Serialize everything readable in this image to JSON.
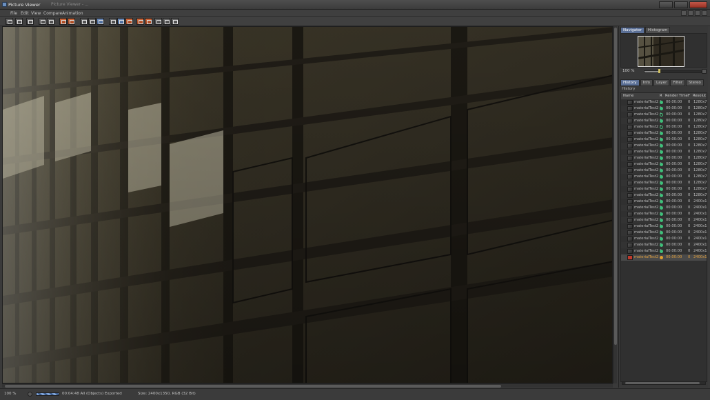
{
  "window": {
    "title": "Picture Viewer",
    "ghost_title": "Picture Viewer - ..."
  },
  "menu": {
    "items": [
      "File",
      "Edit",
      "View",
      "Compare",
      "Animation"
    ]
  },
  "toolbar": {
    "buttons": [
      "open-icon",
      "save-icon",
      "export-icon",
      "zoom-in-icon",
      "zoom-out-icon",
      "ab-compare-icon",
      "split-icon",
      "fit-icon",
      "region-icon",
      "channel-icon",
      "display-icon",
      "rgb-icon",
      "lut-icon",
      "alpha-icon",
      "ab-icon",
      "stereo-icon",
      "fullscreen-icon"
    ]
  },
  "navigator": {
    "tabs": [
      "Navigator",
      "Histogram"
    ],
    "zoom": "100 %",
    "zoom_fraction": 0.25
  },
  "info_tabs": [
    "History",
    "Info",
    "Layer",
    "Filter",
    "Stereo"
  ],
  "history": {
    "label": "History",
    "headers": {
      "name": "Name",
      "r": "R",
      "render_time": "Render Time",
      "f": "F",
      "resolution": "Resolut"
    },
    "rows": [
      {
        "name": "materialTest2 *",
        "time": "00:00:00",
        "f": "0",
        "res": "1280x7",
        "status": "done"
      },
      {
        "name": "materialTest2 *",
        "time": "00:00:00",
        "f": "0",
        "res": "1280x7",
        "status": "done"
      },
      {
        "name": "materialTest2 *",
        "time": "00:00:00",
        "f": "0",
        "res": "1280x7",
        "status": "open"
      },
      {
        "name": "materialTest2 *",
        "time": "00:00:00",
        "f": "0",
        "res": "1280x7",
        "status": "done"
      },
      {
        "name": "materialTest2 *",
        "time": "00:00:00",
        "f": "0",
        "res": "1280x7",
        "status": "open"
      },
      {
        "name": "materialTest2 *",
        "time": "00:00:00",
        "f": "0",
        "res": "1280x7",
        "status": "done"
      },
      {
        "name": "materialTest2 *",
        "time": "00:00:00",
        "f": "0",
        "res": "1280x7",
        "status": "done"
      },
      {
        "name": "materialTest2 *",
        "time": "00:00:00",
        "f": "0",
        "res": "1280x7",
        "status": "done"
      },
      {
        "name": "materialTest2 *",
        "time": "00:00:00",
        "f": "0",
        "res": "1280x7",
        "status": "done"
      },
      {
        "name": "materialTest2 *",
        "time": "00:00:00",
        "f": "0",
        "res": "1280x7",
        "status": "done"
      },
      {
        "name": "materialTest2 *",
        "time": "00:00:00",
        "f": "0",
        "res": "1280x7",
        "status": "done"
      },
      {
        "name": "materialTest2 *",
        "time": "00:00:00",
        "f": "0",
        "res": "1280x7",
        "status": "done"
      },
      {
        "name": "materialTest2 *",
        "time": "00:00:00",
        "f": "0",
        "res": "1280x7",
        "status": "done"
      },
      {
        "name": "materialTest2 *",
        "time": "00:00:00",
        "f": "0",
        "res": "1280x7",
        "status": "done"
      },
      {
        "name": "materialTest2 *",
        "time": "00:00:00",
        "f": "0",
        "res": "1280x7",
        "status": "done"
      },
      {
        "name": "materialTest2 *",
        "time": "00:00:00",
        "f": "0",
        "res": "1280x7",
        "status": "done"
      },
      {
        "name": "materialTest2 *",
        "time": "00:00:00",
        "f": "0",
        "res": "2400x1",
        "status": "done"
      },
      {
        "name": "materialTest2 *",
        "time": "00:00:00",
        "f": "0",
        "res": "2400x1",
        "status": "done"
      },
      {
        "name": "materialTest2 *",
        "time": "00:00:00",
        "f": "0",
        "res": "2400x1",
        "status": "done"
      },
      {
        "name": "materialTest2 *",
        "time": "00:00:00",
        "f": "0",
        "res": "2400x1",
        "status": "done"
      },
      {
        "name": "materialTest2 *",
        "time": "00:00:00",
        "f": "0",
        "res": "2400x1",
        "status": "done"
      },
      {
        "name": "materialTest2 *",
        "time": "00:00:00",
        "f": "0",
        "res": "2400x1",
        "status": "done"
      },
      {
        "name": "materialTest2 *",
        "time": "00:00:00",
        "f": "0",
        "res": "2400x1",
        "status": "done"
      },
      {
        "name": "materialTest2 *",
        "time": "00:00:00",
        "f": "0",
        "res": "2400x1",
        "status": "done"
      },
      {
        "name": "materialTest2 *",
        "time": "00:00:00",
        "f": "0",
        "res": "2400x1",
        "status": "done"
      },
      {
        "name": "materialTest2",
        "time": "00:00:00",
        "f": "0",
        "res": "2400x1",
        "status": "active"
      }
    ]
  },
  "status": {
    "zoom": "100 %",
    "render_info": "00:04:48 All (Objects) Exported",
    "size_info": "Size: 2400x1350, RGB (32 Bit)"
  },
  "colors": {
    "accent_tab": "#5a6f96",
    "status_done": "#3fc07a",
    "status_active": "#e0a030",
    "toolbar_orange": "#d46a3b"
  }
}
